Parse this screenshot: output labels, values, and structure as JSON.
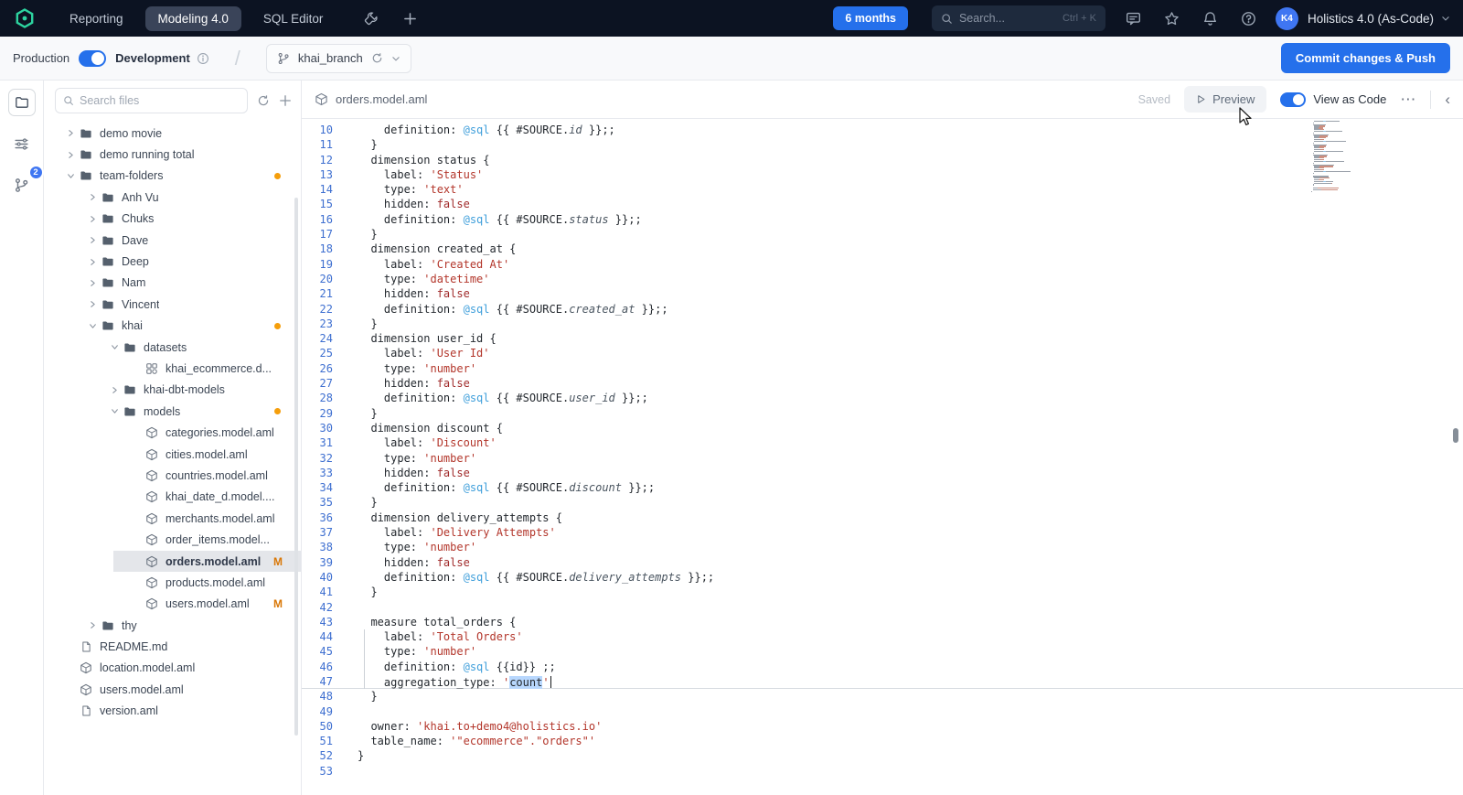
{
  "topbar": {
    "nav": {
      "reporting": "Reporting",
      "modeling": "Modeling 4.0",
      "sql_editor": "SQL Editor"
    },
    "time_range_button": "6 months",
    "search": {
      "placeholder": "Search...",
      "shortcut": "Ctrl + K"
    },
    "avatar_initials": "K4",
    "workspace_name": "Holistics 4.0 (As-Code)"
  },
  "env_bar": {
    "production_label": "Production",
    "development_label": "Development",
    "branch_name": "khai_branch",
    "commit_button": "Commit changes & Push"
  },
  "activity_rail": {
    "git_badge_count": "2"
  },
  "sidebar": {
    "search_placeholder": "Search files",
    "tree": [
      {
        "label": "demo movie",
        "type": "folder",
        "state": "collapsed",
        "depth": 0
      },
      {
        "label": "demo running total",
        "type": "folder",
        "state": "collapsed",
        "depth": 0
      },
      {
        "label": "team-folders",
        "type": "folder",
        "state": "expanded",
        "depth": 0,
        "dot": true
      },
      {
        "label": "Anh Vu",
        "type": "folder",
        "state": "collapsed",
        "depth": 1
      },
      {
        "label": "Chuks",
        "type": "folder",
        "state": "collapsed",
        "depth": 1
      },
      {
        "label": "Dave",
        "type": "folder",
        "state": "collapsed",
        "depth": 1
      },
      {
        "label": "Deep",
        "type": "folder",
        "state": "collapsed",
        "depth": 1
      },
      {
        "label": "Nam",
        "type": "folder",
        "state": "collapsed",
        "depth": 1
      },
      {
        "label": "Vincent",
        "type": "folder",
        "state": "collapsed",
        "depth": 1
      },
      {
        "label": "khai",
        "type": "folder",
        "state": "expanded",
        "depth": 1,
        "dot": true
      },
      {
        "label": "datasets",
        "type": "folder",
        "state": "expanded",
        "depth": 2
      },
      {
        "label": "khai_ecommerce.d...",
        "type": "dataset",
        "depth": 3
      },
      {
        "label": "khai-dbt-models",
        "type": "folder",
        "state": "collapsed",
        "depth": 2
      },
      {
        "label": "models",
        "type": "folder",
        "state": "expanded",
        "depth": 2,
        "dot": true
      },
      {
        "label": "categories.model.aml",
        "type": "model",
        "depth": 3
      },
      {
        "label": "cities.model.aml",
        "type": "model",
        "depth": 3
      },
      {
        "label": "countries.model.aml",
        "type": "model",
        "depth": 3
      },
      {
        "label": "khai_date_d.model....",
        "type": "model",
        "depth": 3
      },
      {
        "label": "merchants.model.aml",
        "type": "model",
        "depth": 3
      },
      {
        "label": "order_items.model...",
        "type": "model",
        "depth": 3
      },
      {
        "label": "orders.model.aml",
        "type": "model",
        "depth": 3,
        "selected": true,
        "badge": "M"
      },
      {
        "label": "products.model.aml",
        "type": "model",
        "depth": 3
      },
      {
        "label": "users.model.aml",
        "type": "model",
        "depth": 3,
        "badge": "M"
      },
      {
        "label": "thy",
        "type": "folder",
        "state": "collapsed",
        "depth": 1
      },
      {
        "label": "README.md",
        "type": "file",
        "depth": 0
      },
      {
        "label": "location.model.aml",
        "type": "model",
        "depth": 0
      },
      {
        "label": "users.model.aml",
        "type": "model",
        "depth": 0
      },
      {
        "label": "version.aml",
        "type": "file",
        "depth": 0
      }
    ]
  },
  "editor": {
    "file_name": "orders.model.aml",
    "status_label": "Saved",
    "preview_button": "Preview",
    "view_toggle_label": "View as Code",
    "active_block_guide": {
      "from_line": 44,
      "to_line": 47
    },
    "cursor": {
      "line": 47,
      "after_text": "count"
    },
    "code": [
      {
        "n": 10,
        "t": [
          [
            "t",
            "    definition: "
          ],
          [
            "q",
            "@sql"
          ],
          [
            "t",
            " {{ #SOURCE."
          ],
          [
            "f",
            "id"
          ],
          [
            "t",
            " }};;"
          ]
        ]
      },
      {
        "n": 11,
        "t": [
          [
            "t",
            "  }"
          ]
        ]
      },
      {
        "n": 12,
        "t": [
          [
            "t",
            "  dimension status {"
          ]
        ]
      },
      {
        "n": 13,
        "t": [
          [
            "t",
            "    label: "
          ],
          [
            "s",
            "'Status'"
          ]
        ]
      },
      {
        "n": 14,
        "t": [
          [
            "t",
            "    type: "
          ],
          [
            "s",
            "'text'"
          ]
        ]
      },
      {
        "n": 15,
        "t": [
          [
            "t",
            "    hidden: "
          ],
          [
            "b",
            "false"
          ]
        ]
      },
      {
        "n": 16,
        "t": [
          [
            "t",
            "    definition: "
          ],
          [
            "q",
            "@sql"
          ],
          [
            "t",
            " {{ #SOURCE."
          ],
          [
            "f",
            "status"
          ],
          [
            "t",
            " }};;"
          ]
        ]
      },
      {
        "n": 17,
        "t": [
          [
            "t",
            "  }"
          ]
        ]
      },
      {
        "n": 18,
        "t": [
          [
            "t",
            "  dimension created_at {"
          ]
        ]
      },
      {
        "n": 19,
        "t": [
          [
            "t",
            "    label: "
          ],
          [
            "s",
            "'Created At'"
          ]
        ]
      },
      {
        "n": 20,
        "t": [
          [
            "t",
            "    type: "
          ],
          [
            "s",
            "'datetime'"
          ]
        ]
      },
      {
        "n": 21,
        "t": [
          [
            "t",
            "    hidden: "
          ],
          [
            "b",
            "false"
          ]
        ]
      },
      {
        "n": 22,
        "t": [
          [
            "t",
            "    definition: "
          ],
          [
            "q",
            "@sql"
          ],
          [
            "t",
            " {{ #SOURCE."
          ],
          [
            "f",
            "created_at"
          ],
          [
            "t",
            " }};;"
          ]
        ]
      },
      {
        "n": 23,
        "t": [
          [
            "t",
            "  }"
          ]
        ]
      },
      {
        "n": 24,
        "t": [
          [
            "t",
            "  dimension user_id {"
          ]
        ]
      },
      {
        "n": 25,
        "t": [
          [
            "t",
            "    label: "
          ],
          [
            "s",
            "'User Id'"
          ]
        ]
      },
      {
        "n": 26,
        "t": [
          [
            "t",
            "    type: "
          ],
          [
            "s",
            "'number'"
          ]
        ]
      },
      {
        "n": 27,
        "t": [
          [
            "t",
            "    hidden: "
          ],
          [
            "b",
            "false"
          ]
        ]
      },
      {
        "n": 28,
        "t": [
          [
            "t",
            "    definition: "
          ],
          [
            "q",
            "@sql"
          ],
          [
            "t",
            " {{ #SOURCE."
          ],
          [
            "f",
            "user_id"
          ],
          [
            "t",
            " }};;"
          ]
        ]
      },
      {
        "n": 29,
        "t": [
          [
            "t",
            "  }"
          ]
        ]
      },
      {
        "n": 30,
        "t": [
          [
            "t",
            "  dimension discount {"
          ]
        ]
      },
      {
        "n": 31,
        "t": [
          [
            "t",
            "    label: "
          ],
          [
            "s",
            "'Discount'"
          ]
        ]
      },
      {
        "n": 32,
        "t": [
          [
            "t",
            "    type: "
          ],
          [
            "s",
            "'number'"
          ]
        ]
      },
      {
        "n": 33,
        "t": [
          [
            "t",
            "    hidden: "
          ],
          [
            "b",
            "false"
          ]
        ]
      },
      {
        "n": 34,
        "t": [
          [
            "t",
            "    definition: "
          ],
          [
            "q",
            "@sql"
          ],
          [
            "t",
            " {{ #SOURCE."
          ],
          [
            "f",
            "discount"
          ],
          [
            "t",
            " }};;"
          ]
        ]
      },
      {
        "n": 35,
        "t": [
          [
            "t",
            "  }"
          ]
        ]
      },
      {
        "n": 36,
        "t": [
          [
            "t",
            "  dimension delivery_attempts {"
          ]
        ]
      },
      {
        "n": 37,
        "t": [
          [
            "t",
            "    label: "
          ],
          [
            "s",
            "'Delivery Attempts'"
          ]
        ]
      },
      {
        "n": 38,
        "t": [
          [
            "t",
            "    type: "
          ],
          [
            "s",
            "'number'"
          ]
        ]
      },
      {
        "n": 39,
        "t": [
          [
            "t",
            "    hidden: "
          ],
          [
            "b",
            "false"
          ]
        ]
      },
      {
        "n": 40,
        "t": [
          [
            "t",
            "    definition: "
          ],
          [
            "q",
            "@sql"
          ],
          [
            "t",
            " {{ #SOURCE."
          ],
          [
            "f",
            "delivery_attempts"
          ],
          [
            "t",
            " }};;"
          ]
        ]
      },
      {
        "n": 41,
        "t": [
          [
            "t",
            "  }"
          ]
        ]
      },
      {
        "n": 42,
        "t": []
      },
      {
        "n": 43,
        "t": [
          [
            "t",
            "  measure total_orders {"
          ]
        ]
      },
      {
        "n": 44,
        "t": [
          [
            "t",
            "    label: "
          ],
          [
            "s",
            "'Total Orders'"
          ]
        ]
      },
      {
        "n": 45,
        "t": [
          [
            "t",
            "    type: "
          ],
          [
            "s",
            "'number'"
          ]
        ]
      },
      {
        "n": 46,
        "t": [
          [
            "t",
            "    definition: "
          ],
          [
            "q",
            "@sql"
          ],
          [
            "t",
            " {{id}} ;;"
          ]
        ]
      },
      {
        "n": 47,
        "t": [
          [
            "t",
            "    aggregation_type: "
          ],
          [
            "s",
            "'"
          ],
          [
            "sel",
            "count"
          ],
          [
            "s",
            "'"
          ]
        ],
        "current": true,
        "caret": true
      },
      {
        "n": 48,
        "t": [
          [
            "t",
            "  }"
          ]
        ]
      },
      {
        "n": 49,
        "t": []
      },
      {
        "n": 50,
        "t": [
          [
            "t",
            "  owner: "
          ],
          [
            "s",
            "'khai.to+demo4@holistics.io'"
          ]
        ]
      },
      {
        "n": 51,
        "t": [
          [
            "t",
            "  table_name: "
          ],
          [
            "s",
            "'\"ecommerce\".\"orders\"'"
          ]
        ]
      },
      {
        "n": 52,
        "t": [
          [
            "t",
            "}"
          ]
        ]
      },
      {
        "n": 53,
        "t": []
      }
    ]
  },
  "colors": {
    "accent_blue": "#2570eb",
    "badge_orange": "#f59e0b",
    "modified_orange": "#d97706",
    "string_red": "#b3362b",
    "sql_blue": "#3f9fdb",
    "line_number_blue": "#3e6fd0",
    "selection_blue": "#b8d7fd"
  }
}
